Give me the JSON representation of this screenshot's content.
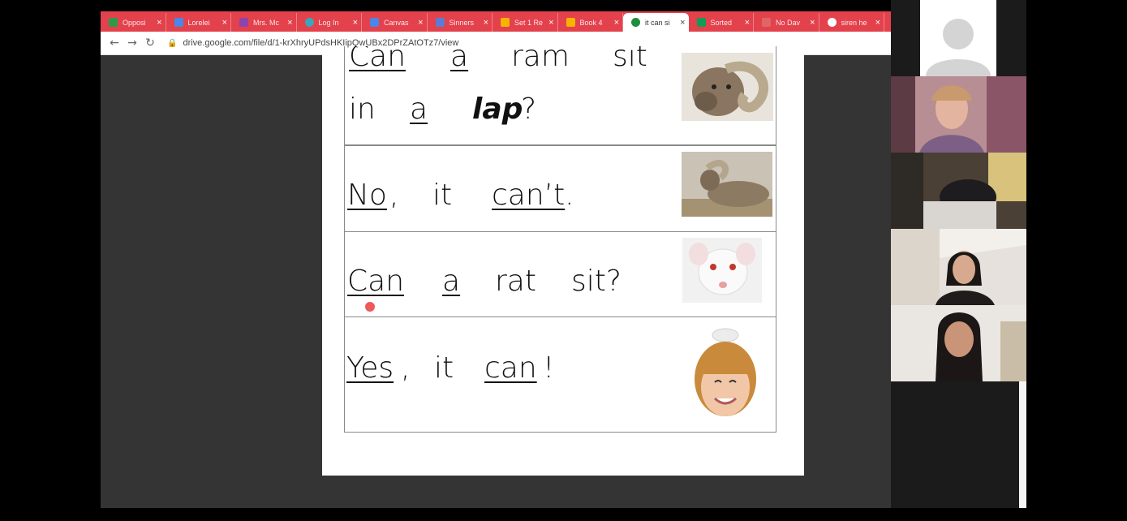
{
  "browser": {
    "tabs": [
      {
        "label": "Opposi",
        "color": "#2d9a4a",
        "shape": "square"
      },
      {
        "label": "Lorelei",
        "color": "#4a86e8",
        "shape": "square"
      },
      {
        "label": "Mrs. Mc",
        "color": "#8e44ad",
        "shape": "square"
      },
      {
        "label": "Log In",
        "color": "#3aa6b9",
        "shape": "round"
      },
      {
        "label": "Canvas",
        "color": "#4a86e8",
        "shape": "square"
      },
      {
        "label": "Sinners",
        "color": "#5b7bd5",
        "shape": "square"
      },
      {
        "label": "Set 1 Re",
        "color": "#f4b400",
        "shape": "square"
      },
      {
        "label": "Book 4",
        "color": "#f4b400",
        "shape": "square"
      },
      {
        "label": "it can si",
        "color": "#1e8e3e",
        "shape": "round",
        "active": true
      },
      {
        "label": "Sorted",
        "color": "#0f9d58",
        "shape": "square"
      },
      {
        "label": "No Dav",
        "color": "#e06666",
        "shape": "square"
      },
      {
        "label": "siren he",
        "color": "#ffffff",
        "shape": "round"
      }
    ],
    "close_glyph": "×",
    "url": "drive.google.com/file/d/1-krXhryUPdsHKIipQwUBx2DPrZAtOTz7/view",
    "back_icon": "←",
    "forward_icon": "→",
    "reload_icon": "↻",
    "lock_icon": "🔒"
  },
  "document": {
    "cell1": {
      "line1": [
        "Can",
        "a",
        "ram",
        "sit"
      ],
      "line2": [
        "in",
        "a",
        "lap",
        "?"
      ]
    },
    "cell2": {
      "w1": "No",
      "p1": ",",
      "w2": "it",
      "w3": "can’t",
      "p2": "."
    },
    "cell3": {
      "w1": "Can",
      "w2": "a",
      "w3": "rat",
      "w4": "sit?"
    },
    "cell4": {
      "w1": "Yes",
      "p1": ",",
      "w2": "it",
      "w3": "can",
      "p2": "!"
    }
  },
  "colors": {
    "tabstrip": "#e3414c",
    "page_bg": "#343434",
    "doc_bg": "#ffffff"
  }
}
